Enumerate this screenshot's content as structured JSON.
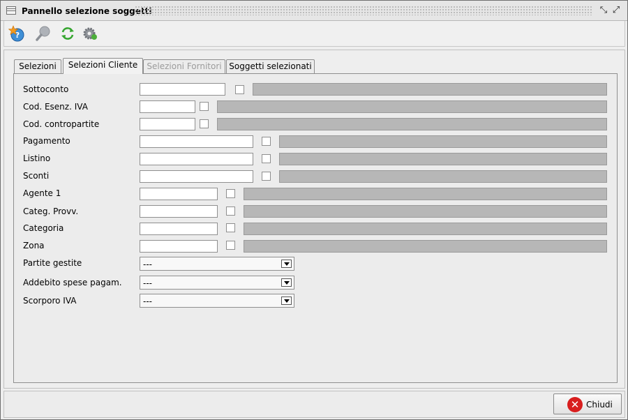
{
  "window": {
    "title": "Pannello selezione soggetti"
  },
  "toolbar": {
    "icons": [
      "help-star-icon",
      "search-icon",
      "refresh-icon",
      "settings-gear-icon"
    ]
  },
  "tabs": [
    {
      "label": "Selezioni",
      "state": "normal"
    },
    {
      "label": "Selezioni Cliente",
      "state": "active"
    },
    {
      "label": "Selezioni Fornitori",
      "state": "disabled"
    },
    {
      "label": "Soggetti selezionati",
      "state": "normal"
    }
  ],
  "fields": [
    {
      "label": "Sottoconto",
      "value": "",
      "checked": false,
      "description": ""
    },
    {
      "label": "Cod. Esenz. IVA",
      "value": "",
      "checked": false,
      "description": ""
    },
    {
      "label": "Cod. contropartite",
      "value": "",
      "checked": false,
      "description": ""
    },
    {
      "label": "Pagamento",
      "value": "",
      "checked": false,
      "description": ""
    },
    {
      "label": "Listino",
      "value": "",
      "checked": false,
      "description": ""
    },
    {
      "label": "Sconti",
      "value": "",
      "checked": false,
      "description": ""
    },
    {
      "label": "Agente 1",
      "value": "",
      "checked": false,
      "description": ""
    },
    {
      "label": "Categ. Provv.",
      "value": "",
      "checked": false,
      "description": ""
    },
    {
      "label": "Categoria",
      "value": "",
      "checked": false,
      "description": ""
    },
    {
      "label": "Zona",
      "value": "",
      "checked": false,
      "description": ""
    }
  ],
  "combos": [
    {
      "label": "Partite gestite",
      "value": "---"
    },
    {
      "label": "Addebito spese pagam.",
      "value": "---"
    },
    {
      "label": "Scorporo IVA",
      "value": "---"
    }
  ],
  "footer": {
    "close_label": "Chiudi"
  },
  "colors": {
    "close_icon": "#d81e1e",
    "description_field": "#b7b7b7"
  }
}
